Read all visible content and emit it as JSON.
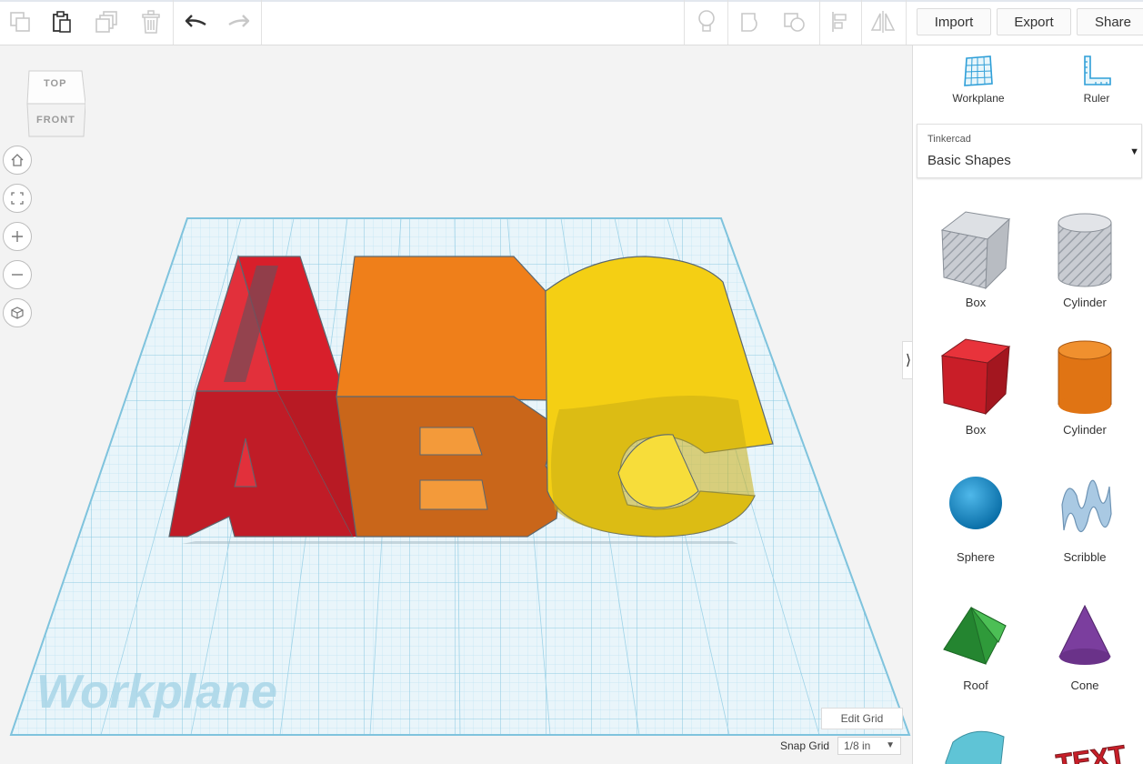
{
  "toolbar": {
    "import_label": "Import",
    "export_label": "Export",
    "share_label": "Share"
  },
  "icons": [
    "copy-icon",
    "paste-icon",
    "duplicate-icon",
    "delete-icon",
    "undo-icon",
    "redo-icon",
    "note-icon",
    "shape-icon",
    "group-icon",
    "align-icon",
    "mirror-icon"
  ],
  "viewcube": {
    "top": "TOP",
    "front": "FRONT"
  },
  "workplane": {
    "watermark": "Workplane",
    "edit_grid": "Edit Grid",
    "snap_label": "Snap Grid",
    "snap_value": "1/8 in"
  },
  "panel": {
    "workplane_label": "Workplane",
    "ruler_label": "Ruler",
    "library_provider": "Tinkercad",
    "library_name": "Basic Shapes",
    "shapes": [
      "Box",
      "Cylinder",
      "Box",
      "Cylinder",
      "Sphere",
      "Scribble",
      "Roof",
      "Cone"
    ],
    "partial_shape": "TEXT"
  },
  "colors": {
    "red": "#d81f2b",
    "orange": "#ef7f1a",
    "yellow": "#f4cf14",
    "grid": "#bfe4f2",
    "accent": "#2f9fd8"
  }
}
